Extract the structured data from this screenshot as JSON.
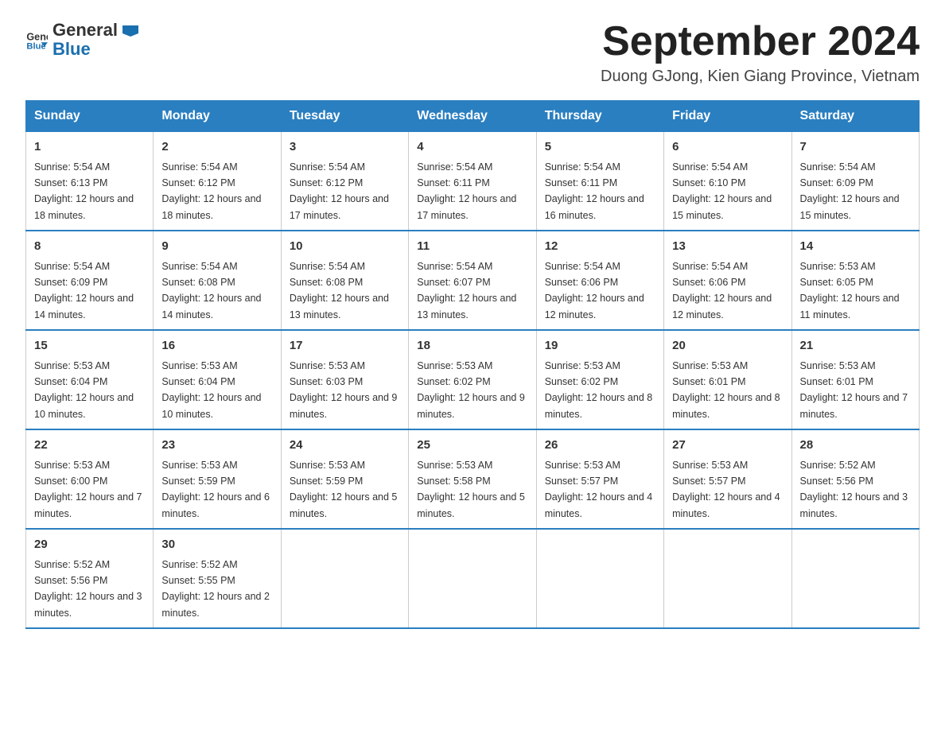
{
  "logo": {
    "text_general": "General",
    "text_blue": "Blue",
    "arrow_color": "#1a6faf"
  },
  "header": {
    "title": "September 2024",
    "subtitle": "Duong GJong, Kien Giang Province, Vietnam"
  },
  "days_of_week": [
    "Sunday",
    "Monday",
    "Tuesday",
    "Wednesday",
    "Thursday",
    "Friday",
    "Saturday"
  ],
  "weeks": [
    [
      {
        "day": "1",
        "sunrise": "Sunrise: 5:54 AM",
        "sunset": "Sunset: 6:13 PM",
        "daylight": "Daylight: 12 hours and 18 minutes."
      },
      {
        "day": "2",
        "sunrise": "Sunrise: 5:54 AM",
        "sunset": "Sunset: 6:12 PM",
        "daylight": "Daylight: 12 hours and 18 minutes."
      },
      {
        "day": "3",
        "sunrise": "Sunrise: 5:54 AM",
        "sunset": "Sunset: 6:12 PM",
        "daylight": "Daylight: 12 hours and 17 minutes."
      },
      {
        "day": "4",
        "sunrise": "Sunrise: 5:54 AM",
        "sunset": "Sunset: 6:11 PM",
        "daylight": "Daylight: 12 hours and 17 minutes."
      },
      {
        "day": "5",
        "sunrise": "Sunrise: 5:54 AM",
        "sunset": "Sunset: 6:11 PM",
        "daylight": "Daylight: 12 hours and 16 minutes."
      },
      {
        "day": "6",
        "sunrise": "Sunrise: 5:54 AM",
        "sunset": "Sunset: 6:10 PM",
        "daylight": "Daylight: 12 hours and 15 minutes."
      },
      {
        "day": "7",
        "sunrise": "Sunrise: 5:54 AM",
        "sunset": "Sunset: 6:09 PM",
        "daylight": "Daylight: 12 hours and 15 minutes."
      }
    ],
    [
      {
        "day": "8",
        "sunrise": "Sunrise: 5:54 AM",
        "sunset": "Sunset: 6:09 PM",
        "daylight": "Daylight: 12 hours and 14 minutes."
      },
      {
        "day": "9",
        "sunrise": "Sunrise: 5:54 AM",
        "sunset": "Sunset: 6:08 PM",
        "daylight": "Daylight: 12 hours and 14 minutes."
      },
      {
        "day": "10",
        "sunrise": "Sunrise: 5:54 AM",
        "sunset": "Sunset: 6:08 PM",
        "daylight": "Daylight: 12 hours and 13 minutes."
      },
      {
        "day": "11",
        "sunrise": "Sunrise: 5:54 AM",
        "sunset": "Sunset: 6:07 PM",
        "daylight": "Daylight: 12 hours and 13 minutes."
      },
      {
        "day": "12",
        "sunrise": "Sunrise: 5:54 AM",
        "sunset": "Sunset: 6:06 PM",
        "daylight": "Daylight: 12 hours and 12 minutes."
      },
      {
        "day": "13",
        "sunrise": "Sunrise: 5:54 AM",
        "sunset": "Sunset: 6:06 PM",
        "daylight": "Daylight: 12 hours and 12 minutes."
      },
      {
        "day": "14",
        "sunrise": "Sunrise: 5:53 AM",
        "sunset": "Sunset: 6:05 PM",
        "daylight": "Daylight: 12 hours and 11 minutes."
      }
    ],
    [
      {
        "day": "15",
        "sunrise": "Sunrise: 5:53 AM",
        "sunset": "Sunset: 6:04 PM",
        "daylight": "Daylight: 12 hours and 10 minutes."
      },
      {
        "day": "16",
        "sunrise": "Sunrise: 5:53 AM",
        "sunset": "Sunset: 6:04 PM",
        "daylight": "Daylight: 12 hours and 10 minutes."
      },
      {
        "day": "17",
        "sunrise": "Sunrise: 5:53 AM",
        "sunset": "Sunset: 6:03 PM",
        "daylight": "Daylight: 12 hours and 9 minutes."
      },
      {
        "day": "18",
        "sunrise": "Sunrise: 5:53 AM",
        "sunset": "Sunset: 6:02 PM",
        "daylight": "Daylight: 12 hours and 9 minutes."
      },
      {
        "day": "19",
        "sunrise": "Sunrise: 5:53 AM",
        "sunset": "Sunset: 6:02 PM",
        "daylight": "Daylight: 12 hours and 8 minutes."
      },
      {
        "day": "20",
        "sunrise": "Sunrise: 5:53 AM",
        "sunset": "Sunset: 6:01 PM",
        "daylight": "Daylight: 12 hours and 8 minutes."
      },
      {
        "day": "21",
        "sunrise": "Sunrise: 5:53 AM",
        "sunset": "Sunset: 6:01 PM",
        "daylight": "Daylight: 12 hours and 7 minutes."
      }
    ],
    [
      {
        "day": "22",
        "sunrise": "Sunrise: 5:53 AM",
        "sunset": "Sunset: 6:00 PM",
        "daylight": "Daylight: 12 hours and 7 minutes."
      },
      {
        "day": "23",
        "sunrise": "Sunrise: 5:53 AM",
        "sunset": "Sunset: 5:59 PM",
        "daylight": "Daylight: 12 hours and 6 minutes."
      },
      {
        "day": "24",
        "sunrise": "Sunrise: 5:53 AM",
        "sunset": "Sunset: 5:59 PM",
        "daylight": "Daylight: 12 hours and 5 minutes."
      },
      {
        "day": "25",
        "sunrise": "Sunrise: 5:53 AM",
        "sunset": "Sunset: 5:58 PM",
        "daylight": "Daylight: 12 hours and 5 minutes."
      },
      {
        "day": "26",
        "sunrise": "Sunrise: 5:53 AM",
        "sunset": "Sunset: 5:57 PM",
        "daylight": "Daylight: 12 hours and 4 minutes."
      },
      {
        "day": "27",
        "sunrise": "Sunrise: 5:53 AM",
        "sunset": "Sunset: 5:57 PM",
        "daylight": "Daylight: 12 hours and 4 minutes."
      },
      {
        "day": "28",
        "sunrise": "Sunrise: 5:52 AM",
        "sunset": "Sunset: 5:56 PM",
        "daylight": "Daylight: 12 hours and 3 minutes."
      }
    ],
    [
      {
        "day": "29",
        "sunrise": "Sunrise: 5:52 AM",
        "sunset": "Sunset: 5:56 PM",
        "daylight": "Daylight: 12 hours and 3 minutes."
      },
      {
        "day": "30",
        "sunrise": "Sunrise: 5:52 AM",
        "sunset": "Sunset: 5:55 PM",
        "daylight": "Daylight: 12 hours and 2 minutes."
      },
      null,
      null,
      null,
      null,
      null
    ]
  ]
}
